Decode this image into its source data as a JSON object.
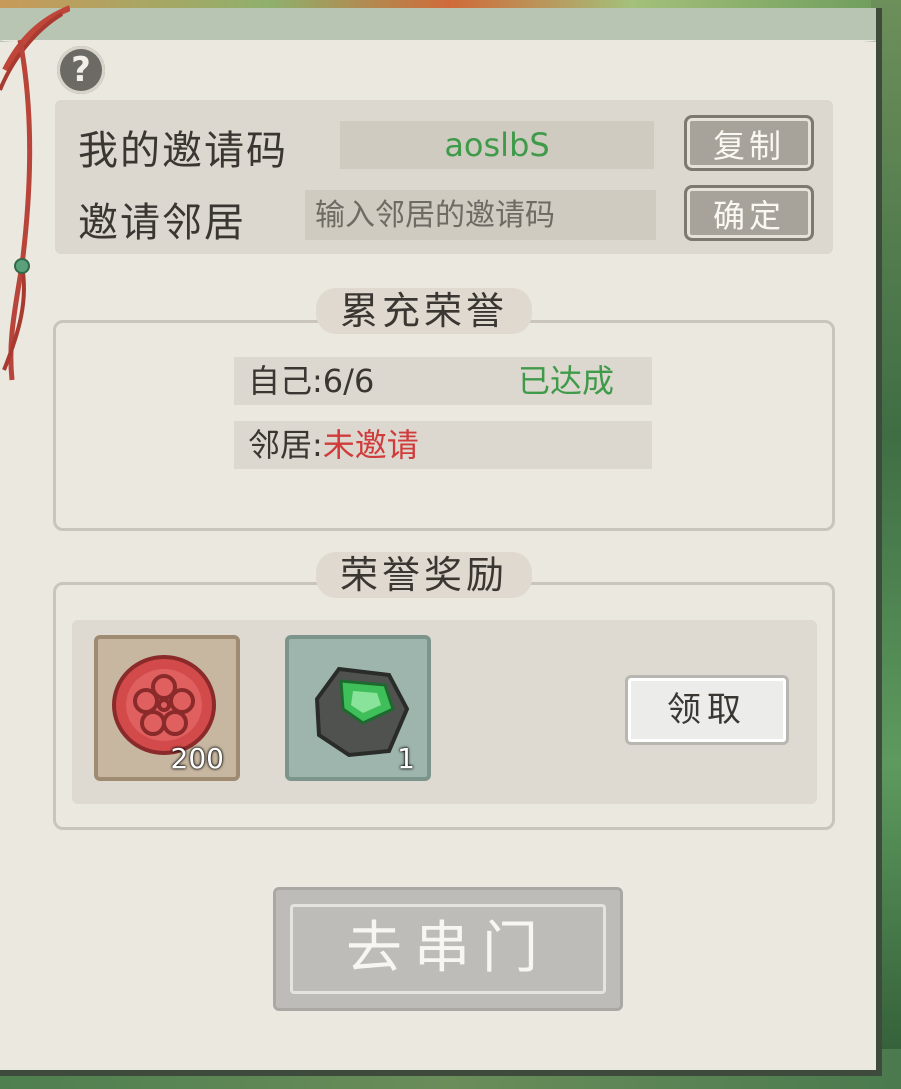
{
  "help": {
    "symbol": "?"
  },
  "invite": {
    "my_code_label": "我的邀请码",
    "my_code_value": "aoslbS",
    "copy_label": "复制",
    "invite_neighbor_label": "邀请邻居",
    "input_placeholder": "输入邻居的邀请码",
    "confirm_label": "确定"
  },
  "honor": {
    "title": "累充荣誉",
    "self_label": "自己:",
    "self_value": "6/6",
    "self_status": "已达成",
    "neighbor_label": "邻居:",
    "neighbor_status": "未邀请"
  },
  "reward": {
    "title": "荣誉奖励",
    "items": [
      {
        "icon": "plum-blossom-token-icon",
        "count": "200"
      },
      {
        "icon": "jade-ore-icon",
        "count": "1"
      }
    ],
    "claim_label": "领取"
  },
  "visit_button": {
    "label": "去串门"
  },
  "colors": {
    "achieved_green": "#3f9a4a",
    "not_invited_red": "#d03b3b",
    "paper": "#ebe8e0"
  }
}
